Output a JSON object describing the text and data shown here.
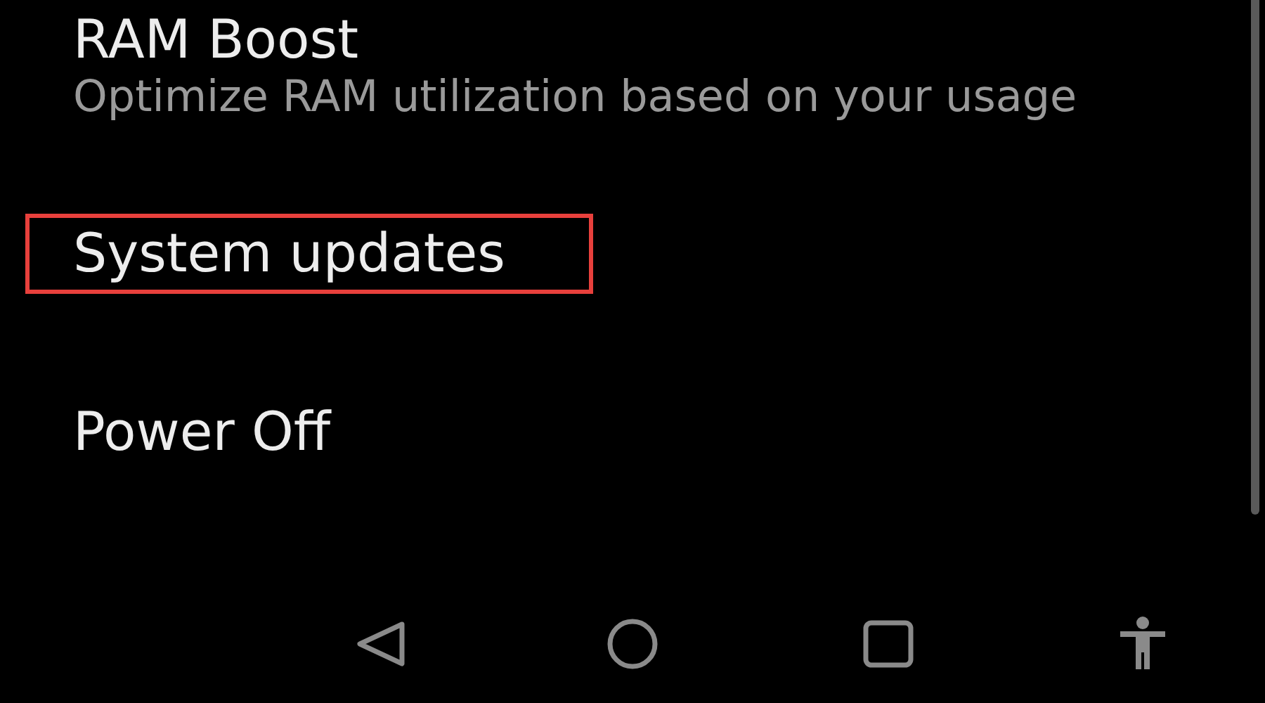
{
  "menu_items": [
    {
      "title": "RAM Boost",
      "subtitle": "Optimize RAM utilization based on your usage",
      "highlighted": false
    },
    {
      "title": "System updates",
      "highlighted": true
    },
    {
      "title": "Power Off",
      "highlighted": false
    }
  ]
}
